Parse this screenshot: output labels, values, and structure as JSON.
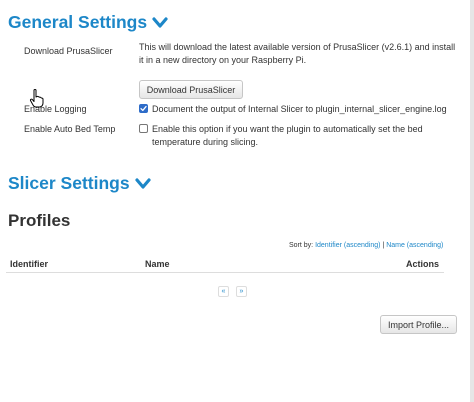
{
  "general": {
    "title": "General Settings",
    "download": {
      "label": "Download PrusaSlicer",
      "description": "This will download the latest available version of PrusaSlicer (v2.6.1) and install it in a new directory on your Raspberry Pi.",
      "button_label": "Download PrusaSlicer"
    },
    "logging": {
      "label": "Enable Logging",
      "checked": true,
      "description": "Document the output of Internal Slicer to plugin_internal_slicer_engine.log"
    },
    "auto_bed_temp": {
      "label": "Enable Auto Bed Temp",
      "checked": false,
      "description": "Enable this option if you want the plugin to automatically set the bed temperature during slicing."
    }
  },
  "slicer": {
    "title": "Slicer Settings"
  },
  "profiles": {
    "title": "Profiles",
    "sort": {
      "prefix": "Sort by:",
      "option_identifier": "Identifier (ascending)",
      "separator": "|",
      "option_name": "Name (ascending)"
    },
    "columns": {
      "identifier": "Identifier",
      "name": "Name",
      "actions": "Actions"
    },
    "pagination": {
      "prev": "«",
      "next": "»"
    },
    "import_label": "Import Profile..."
  },
  "colors": {
    "accent": "#1d87c8",
    "checkbox": "#2e6cc8",
    "text": "#333333"
  },
  "icons": {
    "section_toggle": "chevron-down-icon",
    "pointer": "hand-cursor-icon"
  }
}
